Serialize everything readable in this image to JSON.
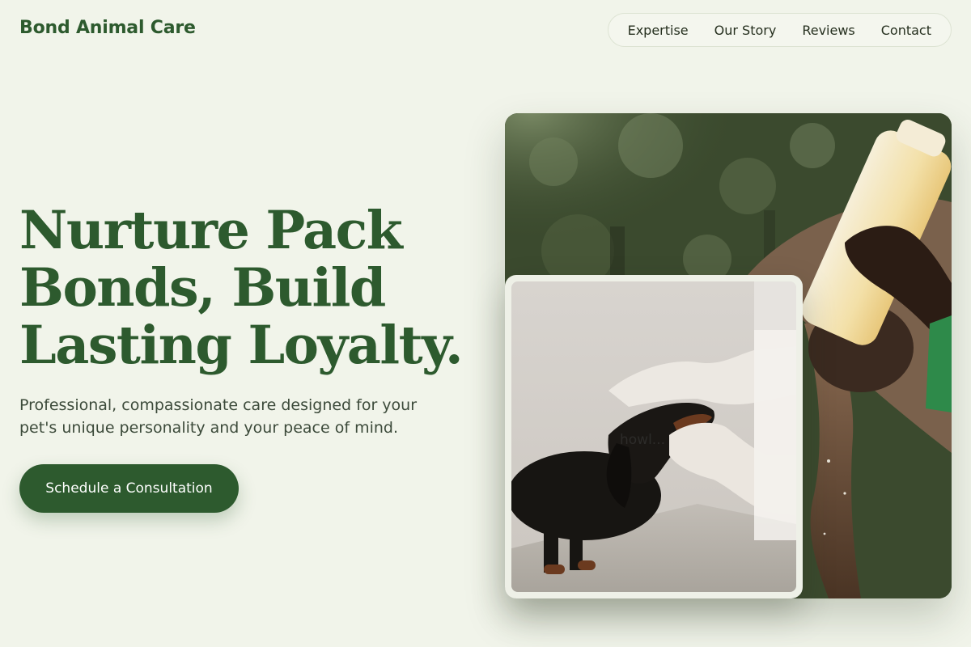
{
  "brand": {
    "name": "Bond Animal Care"
  },
  "nav": {
    "items": [
      {
        "label": "Expertise"
      },
      {
        "label": "Our Story"
      },
      {
        "label": "Reviews"
      },
      {
        "label": "Contact"
      }
    ]
  },
  "hero": {
    "headline_lines": [
      "Nurture Pack",
      "Bonds, Build",
      "Lasting Loyalty."
    ],
    "subtext": "Professional, compassionate care designed for your pet's unique personality and your peace of mind.",
    "cta_label": "Schedule a Consultation"
  },
  "images": {
    "main_alt": "Caretaker bottle-feeding a baby elephant",
    "inset_alt": "Veterinarian examining a dachshund",
    "inset_watermark": "howl..."
  },
  "colors": {
    "brand_green": "#2d5a2e",
    "background": "#f1f4ea",
    "body_text": "#3c4a3a"
  }
}
